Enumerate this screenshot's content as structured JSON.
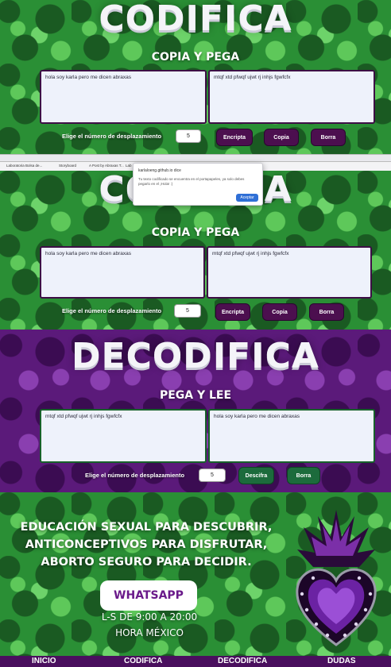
{
  "section1": {
    "title": "CODIFICA",
    "subtitle": "COPIA Y PEGA",
    "input_text": "hola soy karla pero me dicen abraxas",
    "output_text": "mtqf xtd pfwqf ujwt rj inhjs fgwfcfx",
    "shift_label": "Elige el número de desplazamiento",
    "shift_value": "5",
    "buttons": {
      "encrypt": "Encripta",
      "copy": "Copia",
      "clear": "Borra"
    }
  },
  "browser": {
    "bookmarks": [
      "Laboratoria Bolsa de...",
      "Storyboard",
      "A Post by Abraxas T...",
      "Lab"
    ],
    "dialog": {
      "title": "karlaloeng.github.io dice",
      "message": "Tu texto codificado se encuentra en el portapapeles, ya solo debes pegarlo en el ‌¡Hola! :)",
      "button": "Aceptar"
    }
  },
  "section2": {
    "subtitle": "COPIA Y PEGA",
    "input_text": "hola soy karla pero me dicen abraxas",
    "output_text": "mtqf xtd pfwqf ujwt rj inhjs fgwfcfx",
    "shift_label": "Elige el número de desplazamiento",
    "shift_value": "5",
    "buttons": {
      "encrypt": "Encripta",
      "copy": "Copia",
      "clear": "Borra"
    }
  },
  "section3": {
    "title": "DECODIFICA",
    "subtitle": "PEGA Y LEE",
    "input_text": "mtqf xtd pfwqf ujwt rj inhjs fgwfcfx",
    "output_text": "hola soy karla pero me dicen abraxas",
    "shift_label": "Elige el número de desplazamiento",
    "shift_value": "5",
    "buttons": {
      "decrypt": "Descifra",
      "clear": "Borra"
    }
  },
  "promo": {
    "line1": "EDUCACIÓN SEXUAL PARA DESCUBRIR,",
    "line2": "ANTICONCEPTIVOS PARA DISFRUTAR,",
    "line3": "ABORTO SEGURO PARA DECIDIR.",
    "whatsapp": "WHATSAPP",
    "hours": "L-S DE 9:00 A 20:00",
    "timezone": "HORA MÉXICO"
  },
  "nav": {
    "items": [
      "INICIO",
      "CODIFICA",
      "DECODIFICA",
      "DUDAS"
    ]
  },
  "colors": {
    "green_bg": "#2a8f35",
    "purple_bg": "#5b1a7a",
    "button_purple": "#4c0f4f",
    "button_green": "#1c6b3c",
    "nav_bg": "#4a0f5e"
  }
}
